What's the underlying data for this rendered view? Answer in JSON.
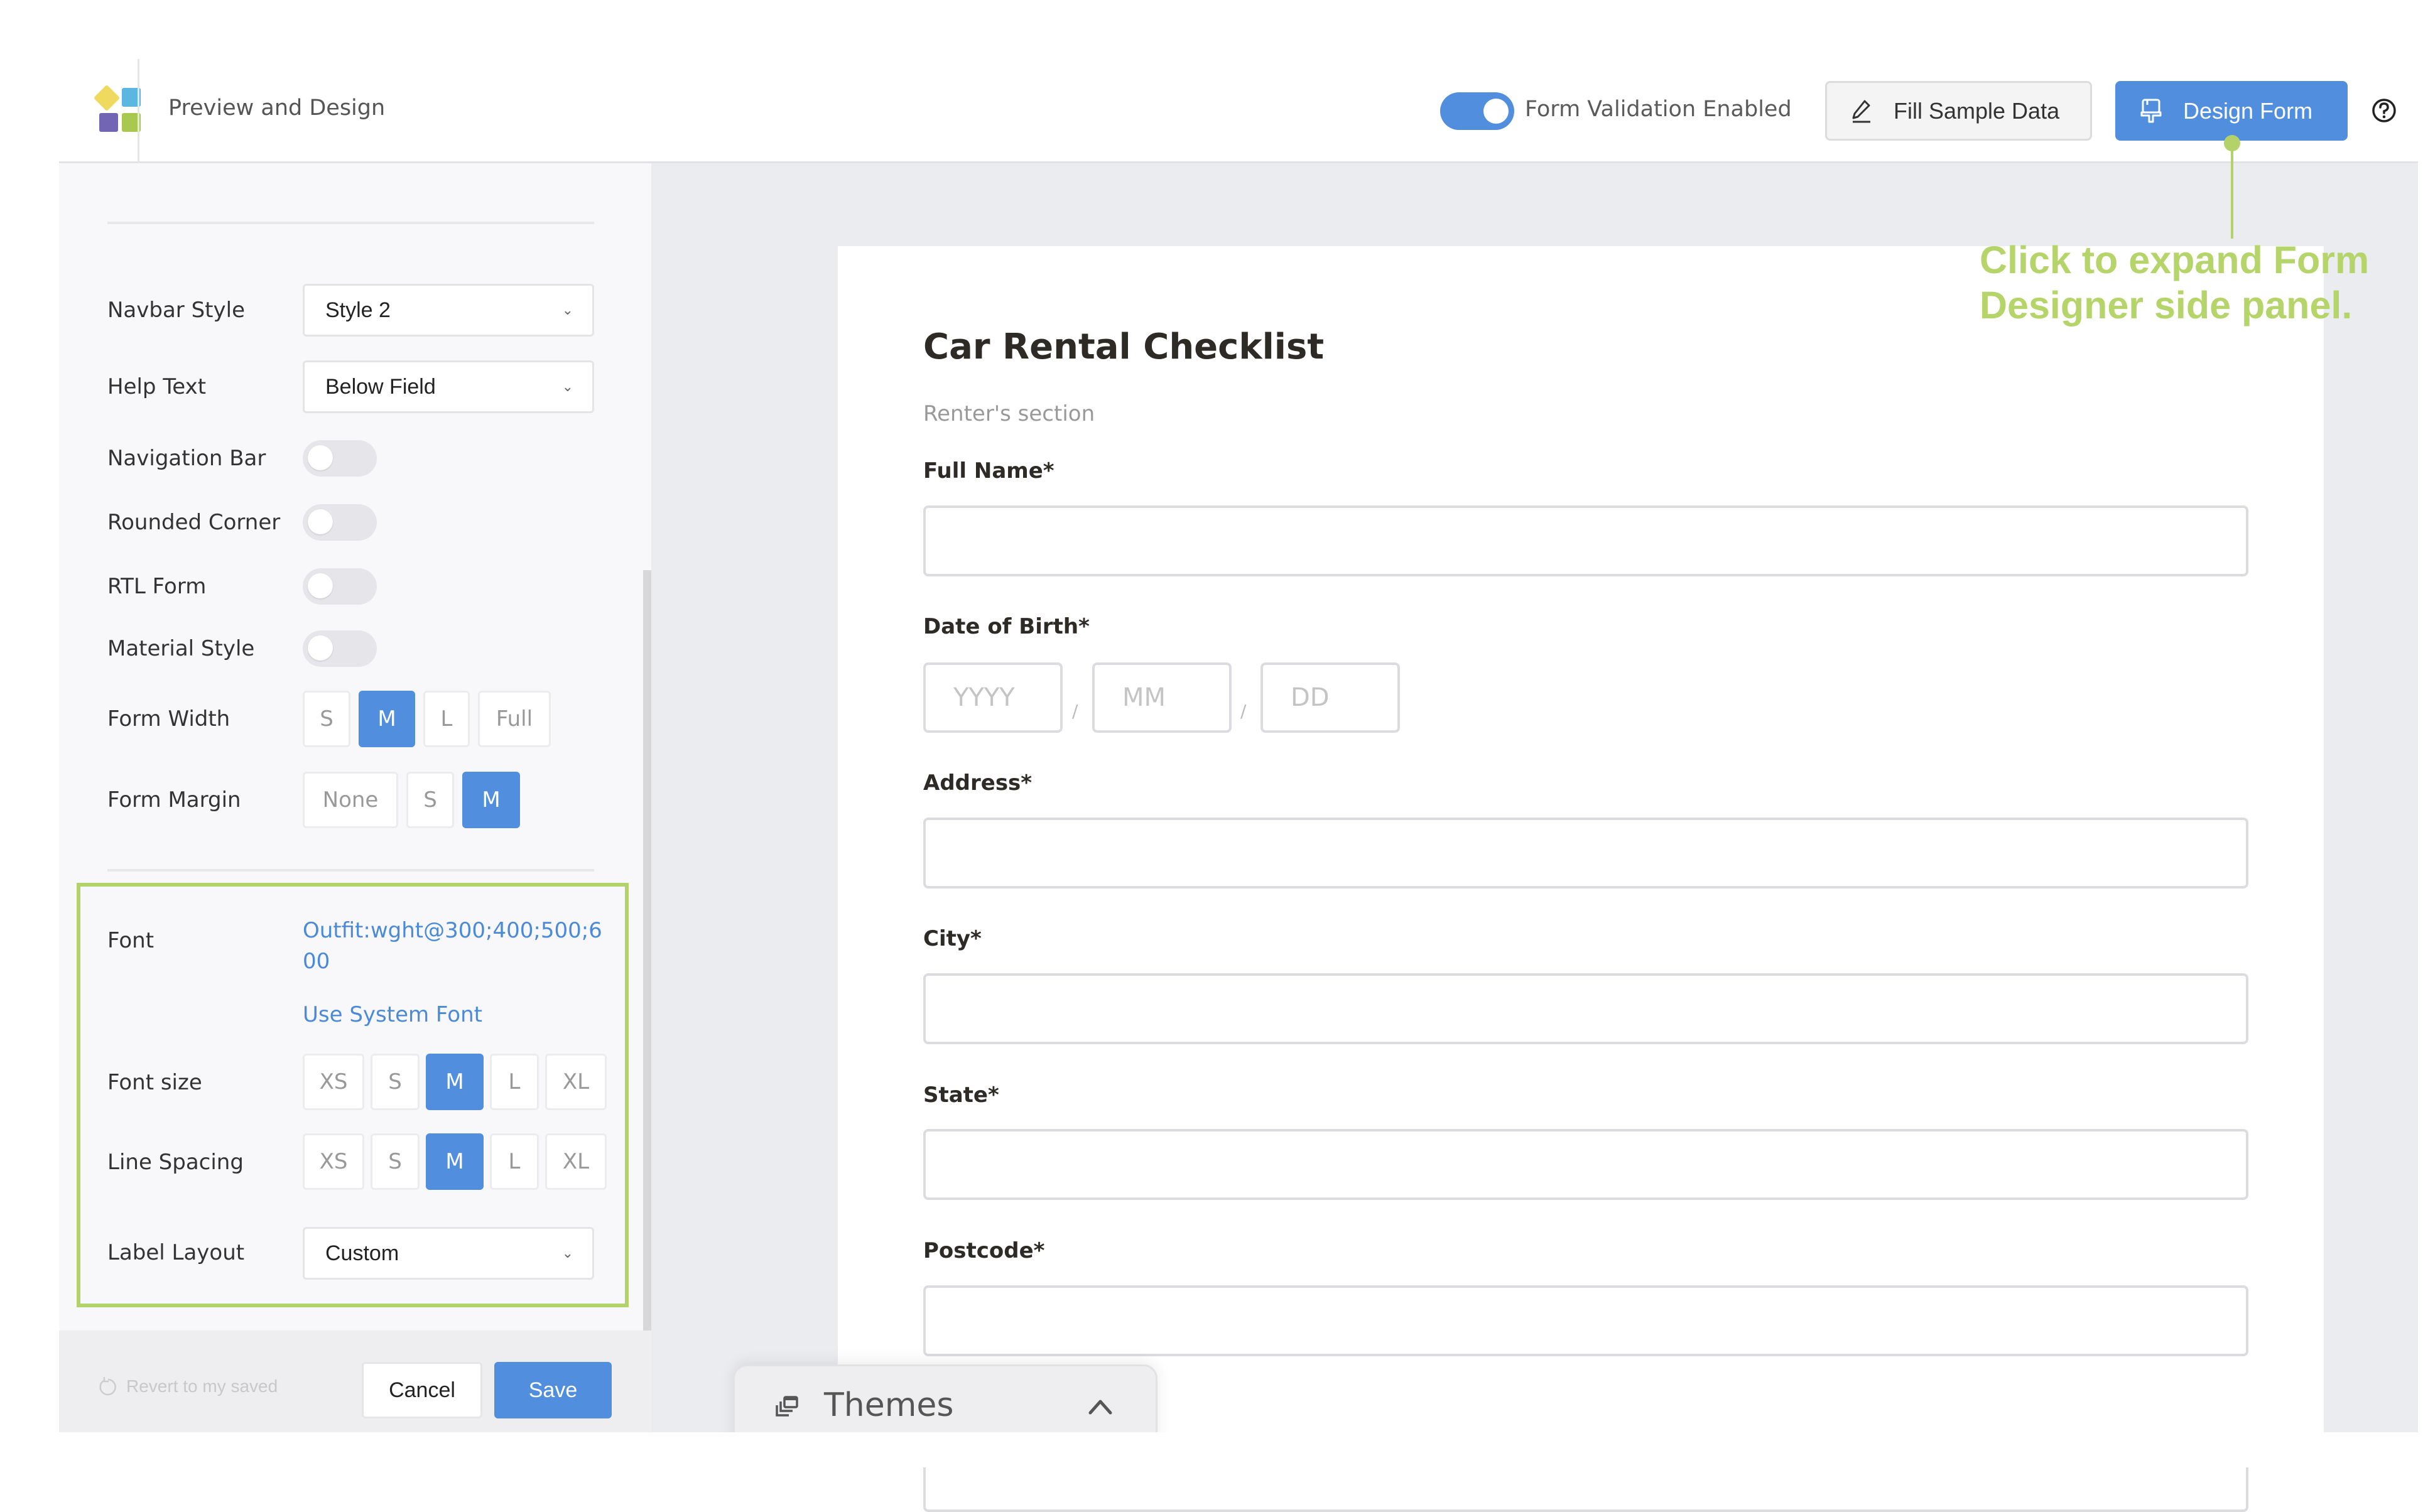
{
  "header": {
    "title": "Preview and Design",
    "validation_toggle": {
      "label": "Form Validation Enabled",
      "on": true
    },
    "fill_sample_label": "Fill Sample Data",
    "design_form_label": "Design Form",
    "help_icon": "question-circle-icon"
  },
  "sidebar": {
    "navbar_style": {
      "label": "Navbar Style",
      "value": "Style 2"
    },
    "help_text": {
      "label": "Help Text",
      "value": "Below Field"
    },
    "toggles": [
      {
        "label": "Navigation Bar",
        "on": false
      },
      {
        "label": "Rounded Corner",
        "on": false
      },
      {
        "label": "RTL Form",
        "on": false
      },
      {
        "label": "Material Style",
        "on": false
      }
    ],
    "form_width": {
      "label": "Form Width",
      "options": [
        "S",
        "M",
        "L",
        "Full"
      ],
      "selected": "M"
    },
    "form_margin": {
      "label": "Form Margin",
      "options": [
        "None",
        "S",
        "M"
      ],
      "selected": "M"
    },
    "font": {
      "label": "Font",
      "value_line1": "Outfit:wght@300;400;500;6",
      "value_line2": "00",
      "system_font_link": "Use System Font"
    },
    "font_size": {
      "label": "Font size",
      "options": [
        "XS",
        "S",
        "M",
        "L",
        "XL"
      ],
      "selected": "M"
    },
    "line_spacing": {
      "label": "Line Spacing",
      "options": [
        "XS",
        "S",
        "M",
        "L",
        "XL"
      ],
      "selected": "M"
    },
    "label_layout": {
      "label": "Label Layout",
      "value": "Custom"
    },
    "footer": {
      "revert_label": "Revert to my saved",
      "cancel_label": "Cancel",
      "save_label": "Save"
    }
  },
  "form": {
    "title": "Car Rental Checklist",
    "section": "Renter's section",
    "fields": {
      "full_name": "Full Name*",
      "dob": "Date of Birth*",
      "address": "Address*",
      "city": "City*",
      "state": "State*",
      "postcode": "Postcode*"
    },
    "dob_placeholders": {
      "year": "YYYY",
      "month": "MM",
      "day": "DD"
    },
    "date_separator": "/"
  },
  "themes": {
    "label": "Themes"
  },
  "annotation": {
    "line1": "Click to expand Form",
    "line2": "Designer side panel."
  },
  "colors": {
    "accent": "#518fde",
    "annotation": "#b5d46a"
  }
}
